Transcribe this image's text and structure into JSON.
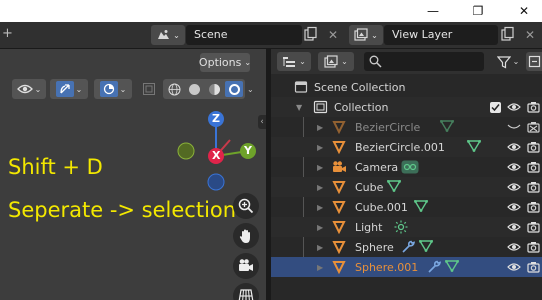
{
  "titlebar": {
    "minimize": "—",
    "maximize": "❐",
    "close": "✕"
  },
  "topbar": {
    "scene": "Scene",
    "view_layer": "View Layer"
  },
  "viewport": {
    "options_label": "Options",
    "overlay_line1": "Shift + D",
    "overlay_line2": "Seperate -> selection",
    "gizmo": {
      "z": "Z",
      "y": "Y",
      "x": "X"
    }
  },
  "outliner": {
    "scene_collection": "Scene Collection",
    "collection": "Collection",
    "items": [
      {
        "name": "BezierCircle",
        "disabled": true,
        "selected": false
      },
      {
        "name": "BezierCircle.001",
        "disabled": false,
        "selected": false
      },
      {
        "name": "Camera",
        "disabled": false,
        "selected": false
      },
      {
        "name": "Cube",
        "disabled": false,
        "selected": false
      },
      {
        "name": "Cube.001",
        "disabled": false,
        "selected": false
      },
      {
        "name": "Light",
        "disabled": false,
        "selected": false
      },
      {
        "name": "Sphere",
        "disabled": false,
        "selected": false
      },
      {
        "name": "Sphere.001",
        "disabled": false,
        "selected": true
      }
    ]
  },
  "colors": {
    "accent_orange": "#e8903a",
    "mesh_green": "#5fc78a",
    "selected_row": "#334d80",
    "overlay_text": "#f3e800"
  }
}
